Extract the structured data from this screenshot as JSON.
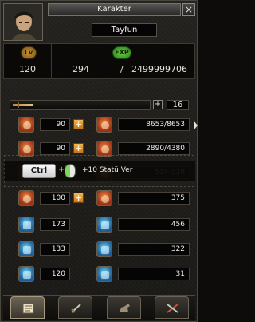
{
  "window": {
    "title": "Karakter"
  },
  "character": {
    "name": "Tayfun"
  },
  "level": {
    "badge": "Lv",
    "value": "120"
  },
  "exp": {
    "badge": "EXP",
    "current": "294",
    "separator": "/",
    "max": "2499999706"
  },
  "points": {
    "available": "16"
  },
  "stats_left": [
    {
      "icon": "strength-icon",
      "value": "90"
    },
    {
      "icon": "health-stat-icon",
      "value": "90"
    },
    {
      "icon": "dexterity-icon",
      "value": ""
    },
    {
      "icon": "intelligence-icon",
      "value": "100"
    },
    {
      "icon": "attack-speed-icon",
      "value": "173"
    },
    {
      "icon": "move-speed-icon",
      "value": "133"
    },
    {
      "icon": "cast-speed-icon",
      "value": "120"
    }
  ],
  "stats_right": [
    {
      "icon": "hp-heart-icon",
      "value": "8653/8653"
    },
    {
      "icon": "mp-orb-icon",
      "value": "2890/4380"
    },
    {
      "icon": "attack-icon",
      "value": "514-520"
    },
    {
      "icon": "defense-shield-icon",
      "value": "375"
    },
    {
      "icon": "magic-attack-icon",
      "value": "456"
    },
    {
      "icon": "magic-defense-icon",
      "value": "322"
    },
    {
      "icon": "evasion-icon",
      "value": "31"
    }
  ],
  "tooltip": {
    "key": "Ctrl",
    "plus": "+",
    "text": "+10 Statü Ver"
  },
  "tabs": [
    {
      "name": "character",
      "icon": "scroll-icon"
    },
    {
      "name": "skills",
      "icon": "sword-icon"
    },
    {
      "name": "emotes",
      "icon": "horse-icon"
    },
    {
      "name": "quests",
      "icon": "crossed-swords-icon"
    }
  ],
  "colors": {
    "plus_button": "#f3a43a",
    "exp_badge": "#5cc23d",
    "level_badge": "#c99536"
  }
}
